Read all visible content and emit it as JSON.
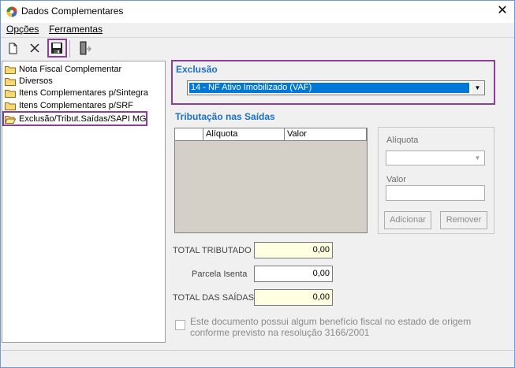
{
  "window": {
    "title": "Dados Complementares",
    "close_glyph": "✕"
  },
  "menu": [
    {
      "label": "Opções"
    },
    {
      "label": "Ferramentas"
    }
  ],
  "toolbar": {
    "icons": [
      "new-document-icon",
      "delete-icon",
      "save-icon",
      "exit-door-icon"
    ]
  },
  "tree": {
    "items": [
      {
        "label": "Nota Fiscal Complementar"
      },
      {
        "label": "Diversos"
      },
      {
        "label": "Itens Complementares p/Sintegra"
      },
      {
        "label": "Itens Complementares p/SRF"
      },
      {
        "label": "Exclusão/Tribut.Saídas/SAPI MG",
        "selected": true
      }
    ]
  },
  "exclusao": {
    "title": "Exclusão",
    "selected_value": "14 - NF Ativo Imobilizado (VAF)"
  },
  "tributacao": {
    "title": "Tributação nas Saídas",
    "columns": [
      "",
      "Alíquota",
      "Valor"
    ],
    "rows": []
  },
  "side_form": {
    "aliquota_label": "Alíquota",
    "valor_label": "Valor",
    "add_button": "Adicionar",
    "remove_button": "Remover"
  },
  "totals": {
    "total_tributado_label": "TOTAL TRIBUTADO",
    "total_tributado_value": "0,00",
    "parcela_isenta_label": "Parcela Isenta",
    "parcela_isenta_value": "0,00",
    "total_saidas_label": "TOTAL DAS SAÍDAS",
    "total_saidas_value": "0,00"
  },
  "checkbox": {
    "label": "Este documento possui algum benefício fiscal no estado de origem conforme previsto na resolução 3166/2001",
    "checked": false
  },
  "colors": {
    "accent_title": "#1d6fc4",
    "highlight_border": "#8b3f96",
    "total_field_bg": "#ffffe1",
    "selection_bg": "#0078d7"
  }
}
